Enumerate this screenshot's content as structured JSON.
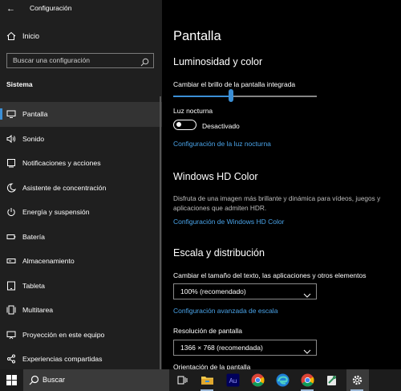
{
  "window": {
    "title": "Configuración"
  },
  "sidebar": {
    "home_label": "Inicio",
    "search_placeholder": "Buscar una configuración",
    "section_label": "Sistema",
    "items": [
      {
        "label": "Pantalla",
        "icon": "monitor-icon",
        "selected": true
      },
      {
        "label": "Sonido",
        "icon": "speaker-icon"
      },
      {
        "label": "Notificaciones y acciones",
        "icon": "notification-icon"
      },
      {
        "label": "Asistente de concentración",
        "icon": "moon-icon"
      },
      {
        "label": "Energía y suspensión",
        "icon": "power-icon"
      },
      {
        "label": "Batería",
        "icon": "battery-icon"
      },
      {
        "label": "Almacenamiento",
        "icon": "storage-icon"
      },
      {
        "label": "Tableta",
        "icon": "tablet-icon"
      },
      {
        "label": "Multitarea",
        "icon": "multitask-icon"
      },
      {
        "label": "Proyección en este equipo",
        "icon": "projection-icon"
      },
      {
        "label": "Experiencias compartidas",
        "icon": "shared-icon"
      }
    ]
  },
  "main": {
    "page_title": "Pantalla",
    "brightness_section": {
      "heading": "Luminosidad y color",
      "slider_label": "Cambiar el brillo de la pantalla integrada",
      "brightness_fraction": 0.4,
      "night_light_label": "Luz nocturna",
      "night_light_state": "Desactivado",
      "night_light_link": "Configuración de la luz nocturna"
    },
    "hdr_section": {
      "heading": "Windows HD Color",
      "description": "Disfruta de una imagen más brillante y dinámica para vídeos, juegos y aplicaciones que admiten HDR.",
      "link": "Configuración de Windows HD Color"
    },
    "scale_section": {
      "heading": "Escala y distribución",
      "scale_label": "Cambiar el tamaño del texto, las aplicaciones y otros elementos",
      "scale_value": "100% (recomendado)",
      "advanced_link": "Configuración avanzada de escala",
      "resolution_label": "Resolución de pantalla",
      "resolution_value": "1366 × 768 (recomendada)",
      "orientation_label": "Orientación de la pantalla"
    }
  },
  "taskbar": {
    "search_placeholder": "Buscar",
    "apps": [
      "task-view-icon",
      "file-explorer-icon",
      "audition-icon",
      "chrome-icon",
      "edge-icon",
      "chrome-icon",
      "app-icon",
      "settings-icon"
    ]
  },
  "colors": {
    "accent": "#3b8fd6",
    "link": "#4aa3e8",
    "sidebar_bg": "#1f1f1f",
    "main_bg": "#000000"
  }
}
